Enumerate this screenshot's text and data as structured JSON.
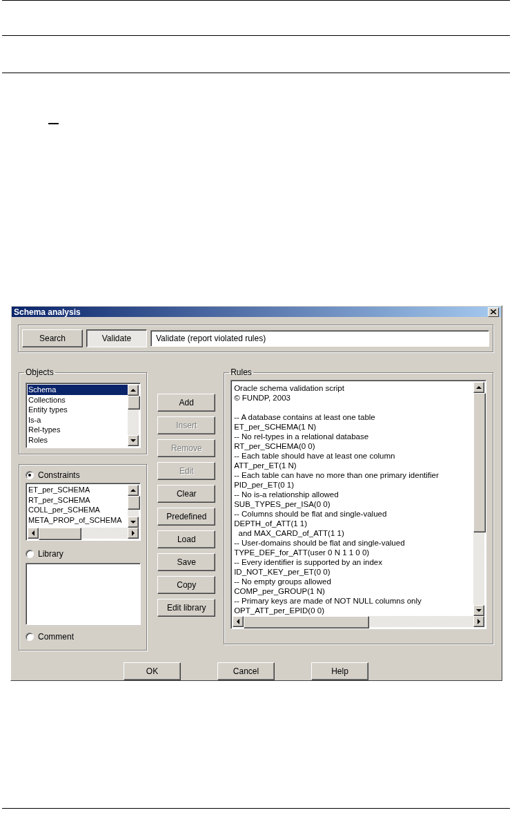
{
  "dialog": {
    "title": "Schema analysis",
    "mode_buttons": [
      {
        "label": "Search",
        "selected": false
      },
      {
        "label": "Validate",
        "selected": true
      }
    ],
    "mode_description": "Validate (report violated rules)",
    "objects": {
      "label": "Objects",
      "items": [
        {
          "label": "Schema",
          "selected": true
        },
        {
          "label": "Collections",
          "selected": false
        },
        {
          "label": "Entity types",
          "selected": false
        },
        {
          "label": "Is-a",
          "selected": false
        },
        {
          "label": "Rel-types",
          "selected": false
        },
        {
          "label": "Roles",
          "selected": false
        }
      ]
    },
    "sources": [
      {
        "label": "Constraints",
        "selected": true,
        "items": [
          "ET_per_SCHEMA",
          "RT_per_SCHEMA",
          "COLL_per_SCHEMA",
          "META_PROP_of_SCHEMA"
        ]
      },
      {
        "label": "Library",
        "selected": false
      },
      {
        "label": "Comment",
        "selected": false
      }
    ],
    "actions": [
      {
        "label": "Add",
        "disabled": false
      },
      {
        "label": "Insert",
        "disabled": true
      },
      {
        "label": "Remove",
        "disabled": true
      },
      {
        "label": "Edit",
        "disabled": true
      },
      {
        "label": "Clear",
        "disabled": false
      },
      {
        "label": "Predefined",
        "disabled": false
      },
      {
        "label": "Load",
        "disabled": false
      },
      {
        "label": "Save",
        "disabled": false
      },
      {
        "label": "Copy",
        "disabled": false
      },
      {
        "label": "Edit library",
        "disabled": false
      }
    ],
    "rules": {
      "label": "Rules",
      "header": [
        "Oracle schema validation script",
        "© FUNDP, 2003"
      ],
      "lines": [
        "-- A database contains at least one table",
        "ET_per_SCHEMA(1 N)",
        "-- No rel-types in a relational database",
        "RT_per_SCHEMA(0 0)",
        "-- Each table should have at least one column",
        "ATT_per_ET(1 N)",
        "-- Each table can have no more than one primary identifier",
        "PID_per_ET(0 1)",
        "-- No is-a relationship allowed",
        "SUB_TYPES_per_ISA(0 0)",
        "-- Columns should be flat and single-valued",
        "DEPTH_of_ATT(1 1)",
        "  and MAX_CARD_of_ATT(1 1)",
        "-- User-domains should be flat and single-valued",
        "TYPE_DEF_for_ATT(user 0 N 1 1 0 0)",
        "-- Every identifier is supported by an index",
        "ID_NOT_KEY_per_ET(0 0)",
        "-- No empty groups allowed",
        "COMP_per_GROUP(1 N)",
        "-- Primary keys are made of NOT NULL columns only",
        "OPT_ATT_per_EPID(0 0)"
      ]
    },
    "buttons": [
      "OK",
      "Cancel",
      "Help"
    ]
  }
}
